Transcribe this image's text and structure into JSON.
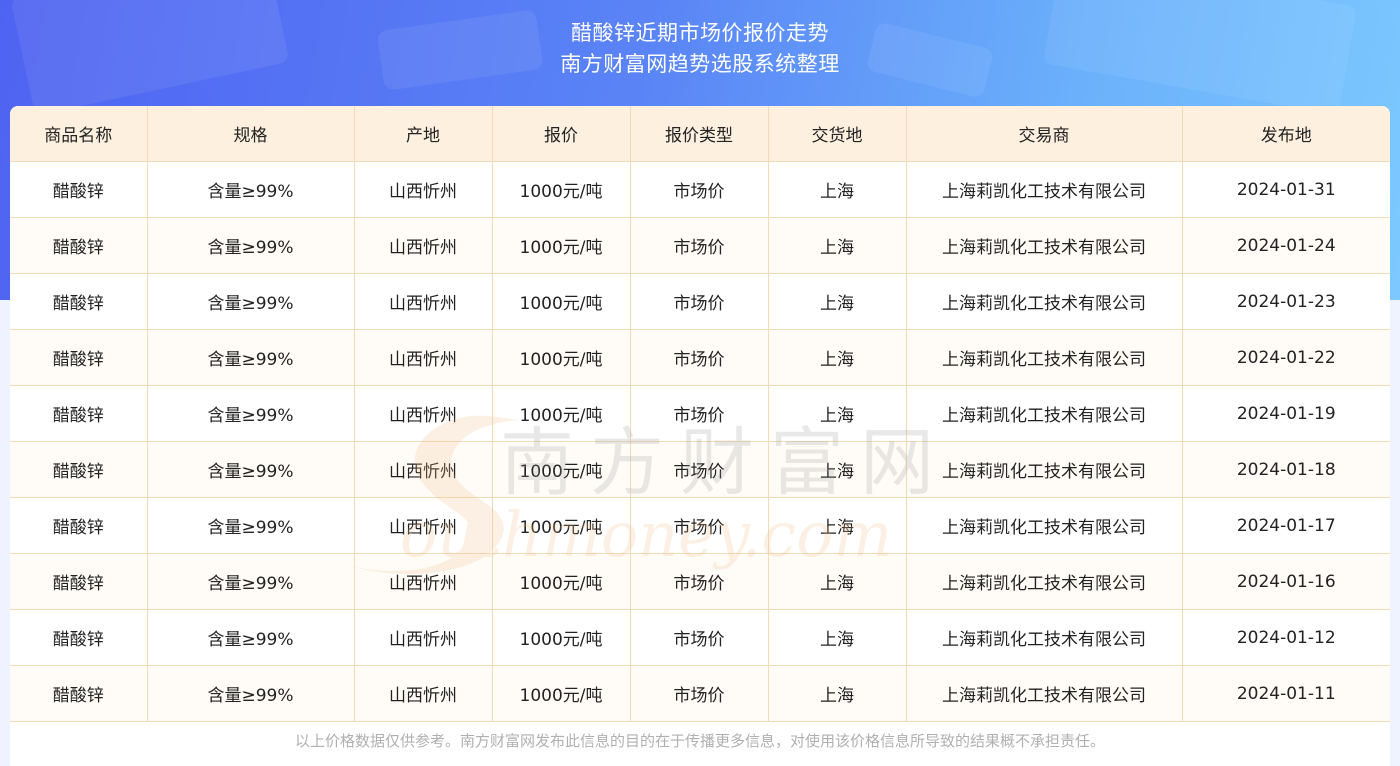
{
  "header": {
    "title_line1": "醋酸锌近期市场价报价走势",
    "title_line2": "南方财富网趋势选股系统整理"
  },
  "table": {
    "columns": [
      "商品名称",
      "规格",
      "产地",
      "报价",
      "报价类型",
      "交货地",
      "交易商",
      "发布地"
    ],
    "rows": [
      [
        "醋酸锌",
        "含量≥99%",
        "山西忻州",
        "1000元/吨",
        "市场价",
        "上海",
        "上海莉凯化工技术有限公司",
        "2024-01-31"
      ],
      [
        "醋酸锌",
        "含量≥99%",
        "山西忻州",
        "1000元/吨",
        "市场价",
        "上海",
        "上海莉凯化工技术有限公司",
        "2024-01-24"
      ],
      [
        "醋酸锌",
        "含量≥99%",
        "山西忻州",
        "1000元/吨",
        "市场价",
        "上海",
        "上海莉凯化工技术有限公司",
        "2024-01-23"
      ],
      [
        "醋酸锌",
        "含量≥99%",
        "山西忻州",
        "1000元/吨",
        "市场价",
        "上海",
        "上海莉凯化工技术有限公司",
        "2024-01-22"
      ],
      [
        "醋酸锌",
        "含量≥99%",
        "山西忻州",
        "1000元/吨",
        "市场价",
        "上海",
        "上海莉凯化工技术有限公司",
        "2024-01-19"
      ],
      [
        "醋酸锌",
        "含量≥99%",
        "山西忻州",
        "1000元/吨",
        "市场价",
        "上海",
        "上海莉凯化工技术有限公司",
        "2024-01-18"
      ],
      [
        "醋酸锌",
        "含量≥99%",
        "山西忻州",
        "1000元/吨",
        "市场价",
        "上海",
        "上海莉凯化工技术有限公司",
        "2024-01-17"
      ],
      [
        "醋酸锌",
        "含量≥99%",
        "山西忻州",
        "1000元/吨",
        "市场价",
        "上海",
        "上海莉凯化工技术有限公司",
        "2024-01-16"
      ],
      [
        "醋酸锌",
        "含量≥99%",
        "山西忻州",
        "1000元/吨",
        "市场价",
        "上海",
        "上海莉凯化工技术有限公司",
        "2024-01-12"
      ],
      [
        "醋酸锌",
        "含量≥99%",
        "山西忻州",
        "1000元/吨",
        "市场价",
        "上海",
        "上海莉凯化工技术有限公司",
        "2024-01-11"
      ]
    ]
  },
  "watermark": {
    "text_cn": "南方财富网",
    "text_en": "outhmoney.com",
    "icon": "southmoney-logo-icon"
  },
  "footer": {
    "disclaimer": "以上价格数据仅供参考。南方财富网发布此信息的目的在于传播更多信息，对使用该价格信息所导致的结果概不承担责任。"
  },
  "colors": {
    "banner_start": "#4f63f2",
    "banner_end": "#7cc8ff",
    "header_row_bg": "#fdf0df",
    "grid_line": "#f4dbb8",
    "watermark": "#f5c089"
  }
}
